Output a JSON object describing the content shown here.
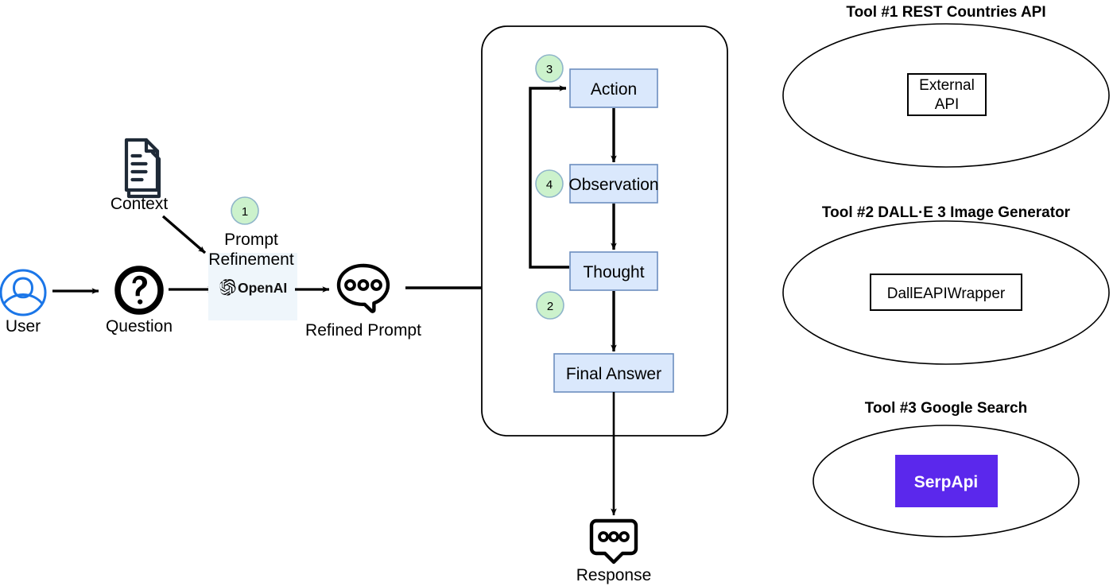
{
  "diagram": {
    "title_alt": "Agentic LLM workflow with ReAct loop and three tools",
    "colors": {
      "box_fill": "#dae8fc",
      "box_stroke": "#6c8ebf",
      "badge_fill": "#ccf2cc",
      "badge_stroke": "#8fb5c9",
      "refine_fill": "#eff6fb",
      "user_blue": "#1b76e8",
      "icon_dark": "#1f2a37",
      "serp_purple": "#5b28ec",
      "line": "#000000"
    }
  },
  "left": {
    "user": {
      "label": "User",
      "icon": "user-avatar-icon"
    },
    "question": {
      "label": "Question",
      "icon": "question-mark-circle-icon"
    },
    "context": {
      "label": "Context",
      "icon": "document-pages-icon"
    },
    "refinement": {
      "title_line1": "Prompt",
      "title_line2": "Refinement",
      "provider_label": "OpenAI",
      "provider_icon": "openai-logo-icon",
      "badge": "1"
    },
    "refined_prompt": {
      "label": "Refined Prompt",
      "icon": "speech-bubble-dots-icon"
    }
  },
  "agent_loop": {
    "container_name": "agent-react-loop-container",
    "nodes": [
      {
        "id": "action",
        "label": "Action",
        "badge": "3"
      },
      {
        "id": "observation",
        "label": "Observation",
        "badge": "4"
      },
      {
        "id": "thought",
        "label": "Thought",
        "badge": "2"
      },
      {
        "id": "final_answer",
        "label": "Final Answer",
        "badge": ""
      }
    ]
  },
  "response": {
    "label": "Response",
    "icon": "speech-bubble-dots-square-icon"
  },
  "tools": [
    {
      "heading": "Tool #1 REST Countries API",
      "inner_kind": "plain-box",
      "inner_lines": [
        "External",
        "API"
      ]
    },
    {
      "heading": "Tool #2 DALL·E 3 Image Generator",
      "inner_kind": "plain-box",
      "inner_lines": [
        "DallEAPIWrapper"
      ]
    },
    {
      "heading": "Tool #3 Google Search",
      "inner_kind": "brand-box",
      "inner_lines": [
        "SerpApi"
      ]
    }
  ]
}
